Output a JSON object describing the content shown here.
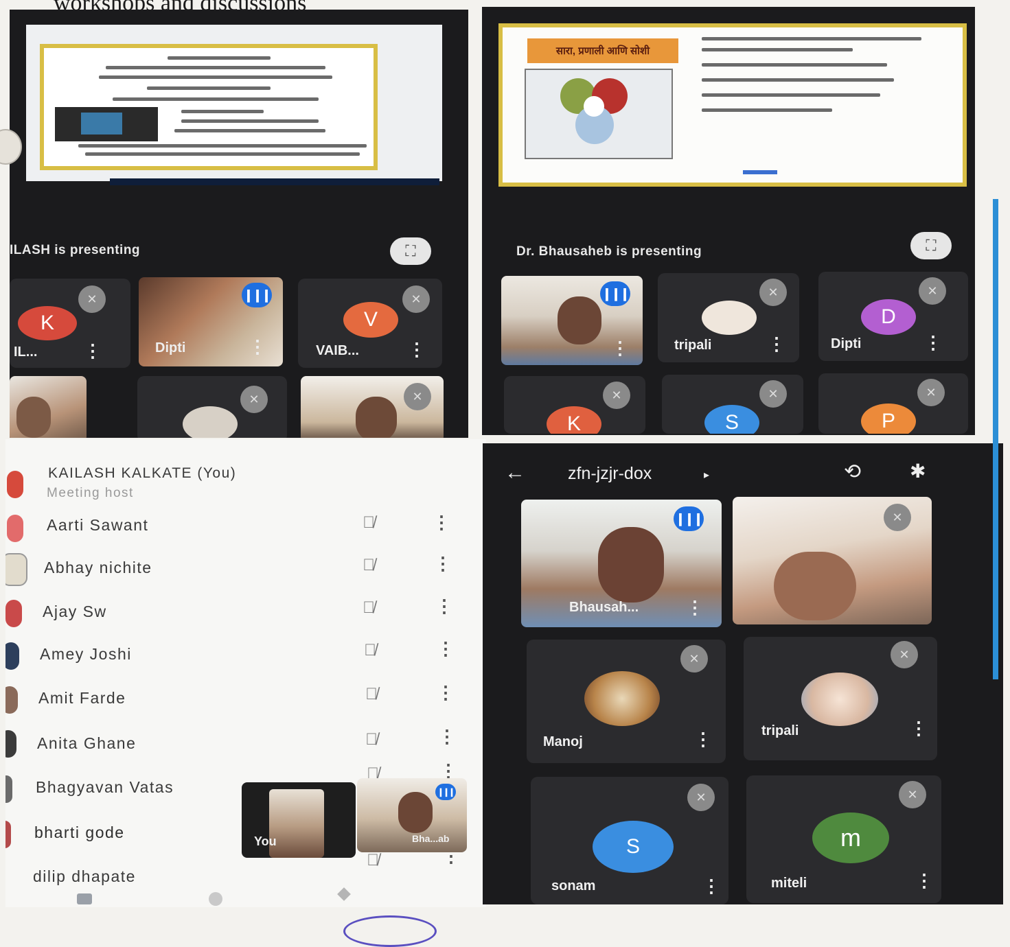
{
  "page": {
    "heading": "workshops and discussions"
  },
  "panel_a": {
    "presenting_text": "ILASH is presenting",
    "tiles": [
      {
        "name": "IL...",
        "initial": "K",
        "color": "#d64a3c"
      },
      {
        "name": "Dipti"
      },
      {
        "name": "VAIB...",
        "initial": "V",
        "color": "#e46a3f"
      }
    ]
  },
  "panel_b": {
    "presenting_text": "Dr. Bhausaheb is presenting",
    "slide_title": "सारा, प्रणाली आणि सोशी",
    "tiles": [
      {
        "name": ""
      },
      {
        "name": "tripali"
      },
      {
        "name": "Dipti",
        "initial": "D",
        "color": "#b35fd1"
      },
      {
        "initial": "K",
        "color": "#e0603f"
      },
      {
        "initial": "S",
        "color": "#3a8ee0"
      },
      {
        "initial": "P",
        "color": "#ec8a3a"
      }
    ]
  },
  "participants": {
    "host": {
      "name": "KAILASH KALKATE (You)",
      "role": "Meeting host"
    },
    "list": [
      "Aarti Sawant",
      "Abhay nichite",
      "Ajay Sw",
      "Amey Joshi",
      "Amit Farde",
      "Anita Ghane",
      "Bhagyavan Vatas",
      "bharti gode",
      "dilip dhapate"
    ],
    "self_view_label": "You",
    "pip_label": "Bha...ab"
  },
  "panel_d": {
    "meeting_code": "zfn-jzjr-dox",
    "tiles": [
      {
        "name": "Bhausah..."
      },
      {
        "name": "tripali"
      },
      {
        "name": "Manoj"
      },
      {
        "name": "tripali"
      },
      {
        "name": "sonam",
        "initial": "S",
        "color": "#3a8ee0"
      },
      {
        "name": "miteli",
        "initial": "m",
        "color": "#4f8a3e"
      }
    ]
  },
  "icons": [
    "back-arrow-icon",
    "switch-camera-icon",
    "bluetooth-icon",
    "mic-off-icon",
    "more-vert-icon",
    "fullscreen-icon",
    "audio-level-icon"
  ]
}
